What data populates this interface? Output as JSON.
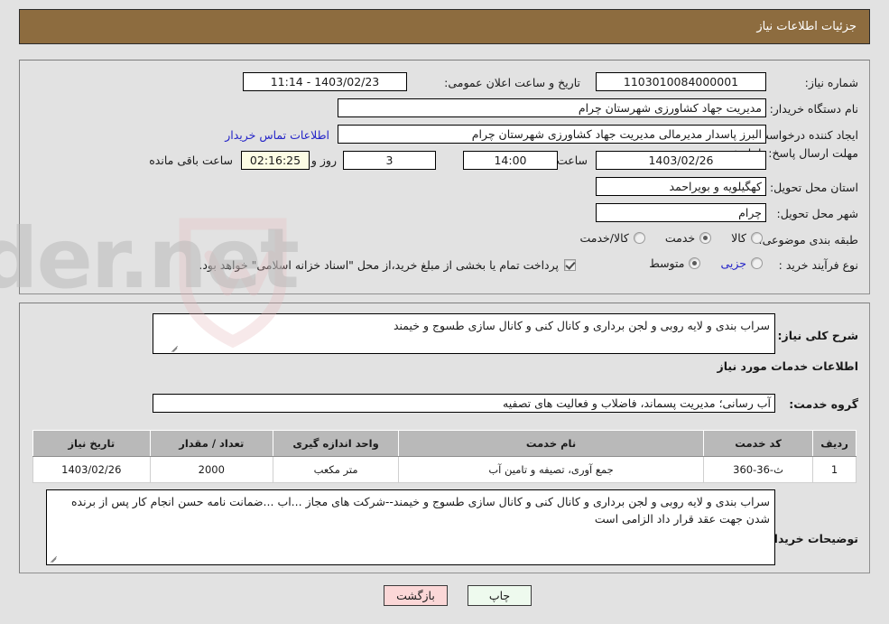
{
  "header": {
    "title": "جزئیات اطلاعات نیاز"
  },
  "form": {
    "need_number_label": "شماره نیاز:",
    "need_number_value": "1103010084000001",
    "announce_datetime_label": "تاریخ و ساعت اعلان عمومی:",
    "announce_datetime_value": "1403/02/23 - 11:14",
    "buyer_org_label": "نام دستگاه خریدار:",
    "buyer_org_value": "مدیریت جهاد کشاورزی شهرستان چرام",
    "requester_label": "ایجاد کننده درخواست:",
    "requester_value": "البرز پاسدار مدیرمالی مدیریت جهاد کشاورزی شهرستان چرام",
    "contact_link": "اطلاعات تماس خریدار",
    "deadline_label": "مهلت ارسال پاسخ: تا تاریخ:",
    "deadline_date": "1403/02/26",
    "deadline_hour_label": "ساعت",
    "deadline_hour": "14:00",
    "days_remaining": "3",
    "days_sep_label": "روز و",
    "time_remaining": "02:16:25",
    "time_remaining_label": "ساعت باقی مانده",
    "province_label": "استان محل تحویل:",
    "province_value": "کهگیلویه و بویراحمد",
    "city_label": "شهر محل تحویل:",
    "city_value": "چرام",
    "category_label": "طبقه بندی موضوعی:",
    "category_options": [
      {
        "label": "کالا",
        "selected": false
      },
      {
        "label": "خدمت",
        "selected": true
      },
      {
        "label": "کالا/خدمت",
        "selected": false
      }
    ],
    "purchase_type_label": "نوع فرآیند خرید :",
    "purchase_type_options": [
      {
        "label": "جزیی",
        "selected": false
      },
      {
        "label": "متوسط",
        "selected": true
      }
    ],
    "treasury_checkbox_checked": true,
    "treasury_note": "پرداخت تمام یا بخشی از مبلغ خرید،از محل \"اسناد خزانه اسلامی\" خواهد بود."
  },
  "details": {
    "general_desc_label": "شرح کلی نیاز:",
    "general_desc_value": "سراب بندی و لایه روبی و لجن برداری و کانال کنی و کانال سازی  طسوج و خیمند",
    "services_section_title": "اطلاعات خدمات مورد نیاز",
    "service_group_label": "گروه خدمت:",
    "service_group_value": "آب رسانی؛ مدیریت پسماند، فاضلاب و فعالیت های تصفیه",
    "buyer_notes_label": "توضیحات خریدار:",
    "buyer_notes_value": "سراب بندی و لایه روبی و لجن برداری و کانال کنی و کانال سازی  طسوج و خیمند--شرکت های مجاز ...اب ...ضمانت نامه حسن انجام کار پس از برنده شدن جهت عقد قرار داد الزامی است"
  },
  "table": {
    "columns": [
      "ردیف",
      "کد خدمت",
      "نام خدمت",
      "واحد اندازه گیری",
      "تعداد / مقدار",
      "تاریخ نیاز"
    ],
    "rows": [
      {
        "row": "1",
        "code": "ث-36-360",
        "name": "جمع آوری، تصیفه و تامین آب",
        "unit": "متر مکعب",
        "qty": "2000",
        "date": "1403/02/26"
      }
    ]
  },
  "footer": {
    "print_label": "چاپ",
    "back_label": "بازگشت"
  },
  "watermark": {
    "text": "AriaTender.net"
  },
  "colors": {
    "header_bar": "#8d6c3f",
    "page_bg": "#e2e2e2",
    "link": "#2424c8",
    "timer_bg": "#fcfce4",
    "table_header": "#b9b9b9",
    "btn_print": "#eefaee",
    "btn_back": "#fbd7d7"
  }
}
